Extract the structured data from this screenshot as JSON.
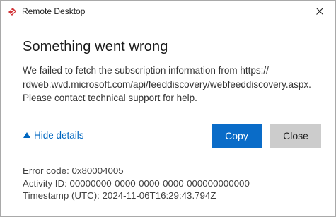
{
  "window": {
    "title": "Remote Desktop"
  },
  "dialog": {
    "heading": "Something went wrong",
    "message_lines": [
      "We failed to fetch the subscription information from https://",
      "rdweb.wvd.microsoft.com/api/feeddiscovery/webfeeddiscovery.aspx.",
      "Please contact technical support for help."
    ],
    "hide_details_label": "Hide details",
    "copy_button_label": "Copy",
    "close_button_label": "Close",
    "details": {
      "error_code": "Error code: 0x80004005",
      "activity_id": "Activity ID: 00000000-0000-0000-0000-000000000000",
      "timestamp": "Timestamp (UTC): 2024-11-06T16:29:43.794Z"
    }
  },
  "colors": {
    "accent": "#0a6cc8",
    "link": "#0067c0",
    "secondary_button": "#cccccc",
    "app_icon": "#d13438"
  },
  "icons": {
    "app": "remote-desktop-icon",
    "close": "close-icon",
    "expander": "triangle-up-icon"
  }
}
